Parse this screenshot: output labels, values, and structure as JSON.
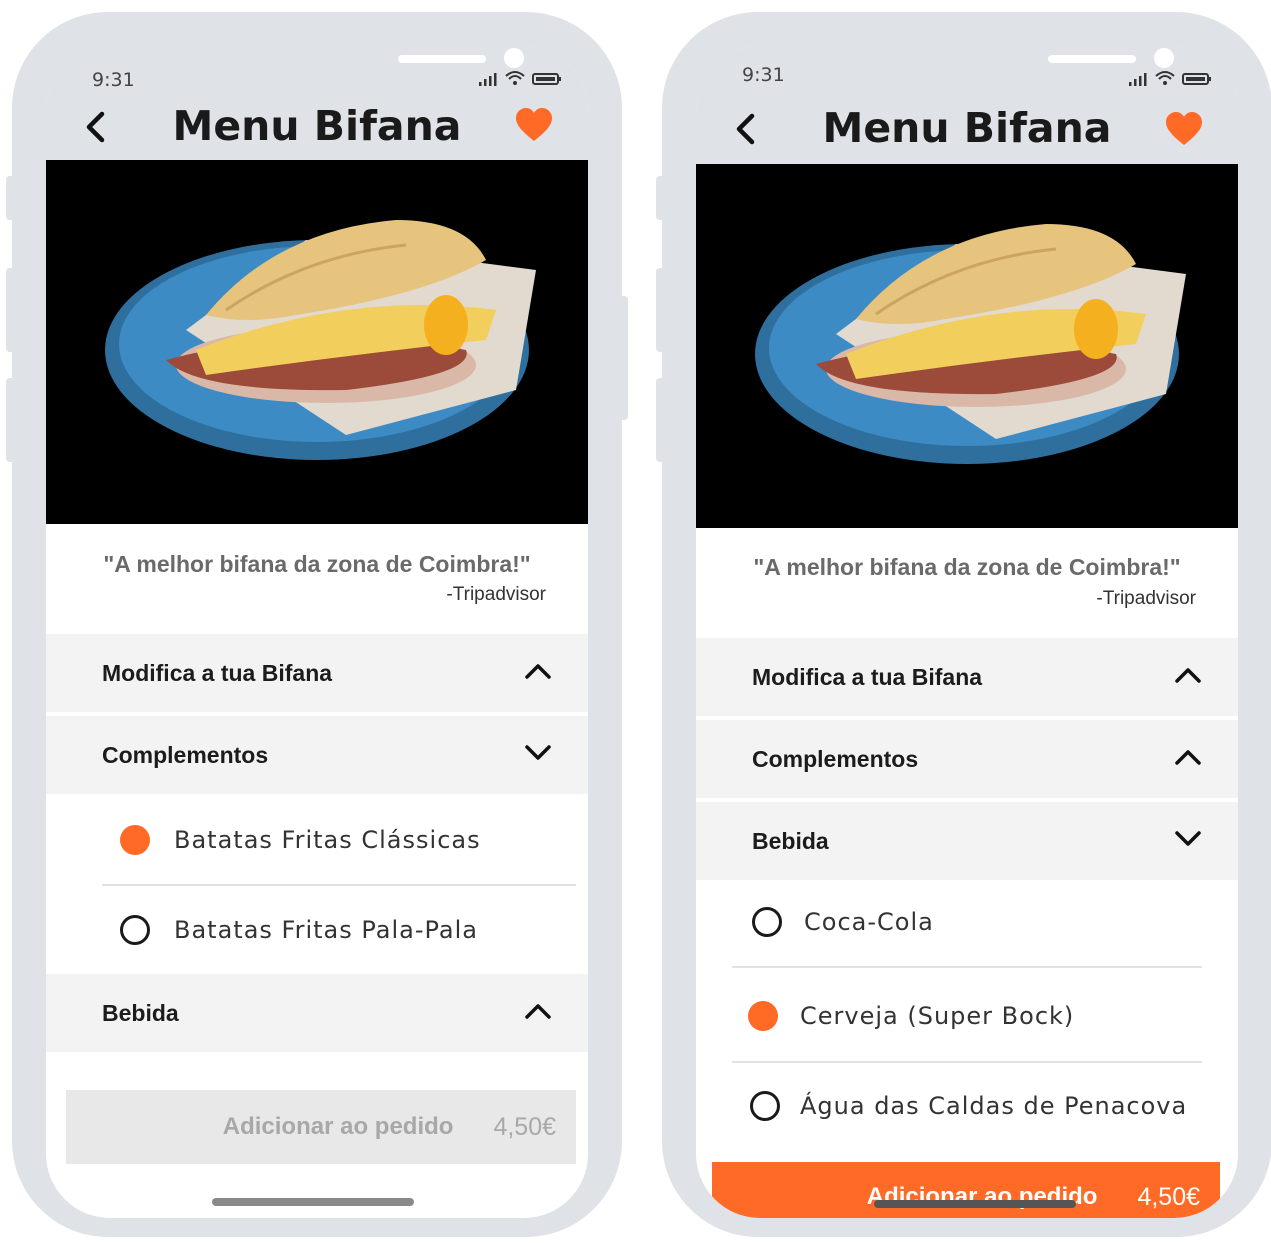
{
  "colors": {
    "accent": "#ff6a26",
    "frame": "#dfe2e6",
    "section_bg": "#f4f3f3"
  },
  "left_screen": {
    "status": {
      "time": "9:31"
    },
    "header": {
      "title": "Menu Bifana",
      "back_icon": "chevron-left-icon",
      "favorite_icon": "heart-icon"
    },
    "review": {
      "quote": "\"A melhor bifana da zona de Coimbra!\"",
      "source": "-Tripadvisor"
    },
    "sections": [
      {
        "label": "Modifica a tua Bifana",
        "state": "collapsed",
        "icon": "chevron-up-icon"
      },
      {
        "label": "Complementos",
        "state": "expanded",
        "icon": "chevron-down-icon"
      },
      {
        "label": "Bebida",
        "state": "collapsed",
        "icon": "chevron-up-icon"
      }
    ],
    "options": [
      {
        "label": "Batatas Fritas Clássicas",
        "selected": true
      },
      {
        "label": "Batatas Fritas Pala-Pala",
        "selected": false
      }
    ],
    "cta": {
      "label": "Adicionar ao pedido",
      "price": "4,50€",
      "enabled": false
    }
  },
  "right_screen": {
    "status": {
      "time": "9:31"
    },
    "header": {
      "title": "Menu Bifana",
      "back_icon": "chevron-left-icon",
      "favorite_icon": "heart-icon"
    },
    "review": {
      "quote": "\"A melhor bifana da zona de Coimbra!\"",
      "source": "-Tripadvisor"
    },
    "sections": [
      {
        "label": "Modifica a tua Bifana",
        "state": "collapsed",
        "icon": "chevron-up-icon"
      },
      {
        "label": "Complementos",
        "state": "collapsed",
        "icon": "chevron-up-icon"
      },
      {
        "label": "Bebida",
        "state": "expanded",
        "icon": "chevron-down-icon"
      }
    ],
    "options": [
      {
        "label": "Coca-Cola",
        "selected": false
      },
      {
        "label": "Cerveja (Super Bock)",
        "selected": true
      },
      {
        "label": "Água das Caldas de Penacova",
        "selected": false
      }
    ],
    "cta": {
      "label": "Adicionar ao pedido",
      "price": "4,50€",
      "enabled": true
    }
  }
}
